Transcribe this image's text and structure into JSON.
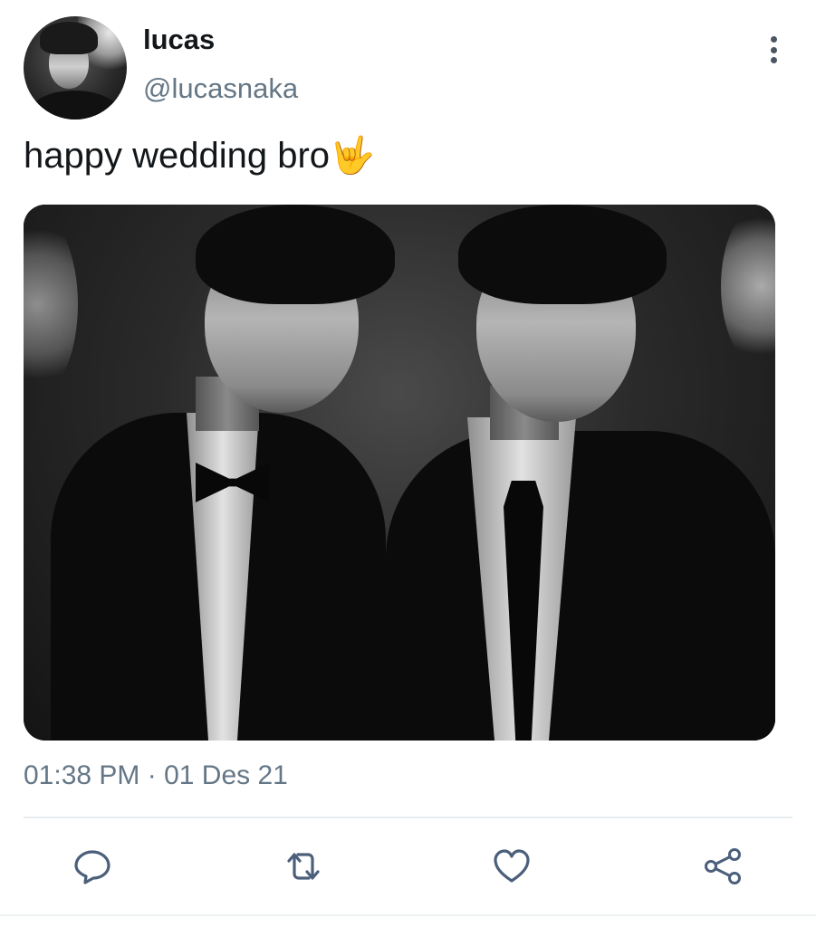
{
  "user": {
    "display_name": "lucas",
    "handle": "@lucasnaka"
  },
  "tweet": {
    "text": "happy wedding bro🤟",
    "timestamp": "01:38 PM · 01 Des 21"
  },
  "actions": [
    {
      "name": "reply",
      "icon": "reply-icon"
    },
    {
      "name": "retweet",
      "icon": "retweet-icon"
    },
    {
      "name": "like",
      "icon": "heart-icon"
    },
    {
      "name": "share",
      "icon": "share-icon"
    }
  ],
  "colors": {
    "text_primary": "#14171a",
    "text_secondary": "#657786",
    "icon": "#4b5f7a",
    "divider": "#e6ecf0"
  }
}
